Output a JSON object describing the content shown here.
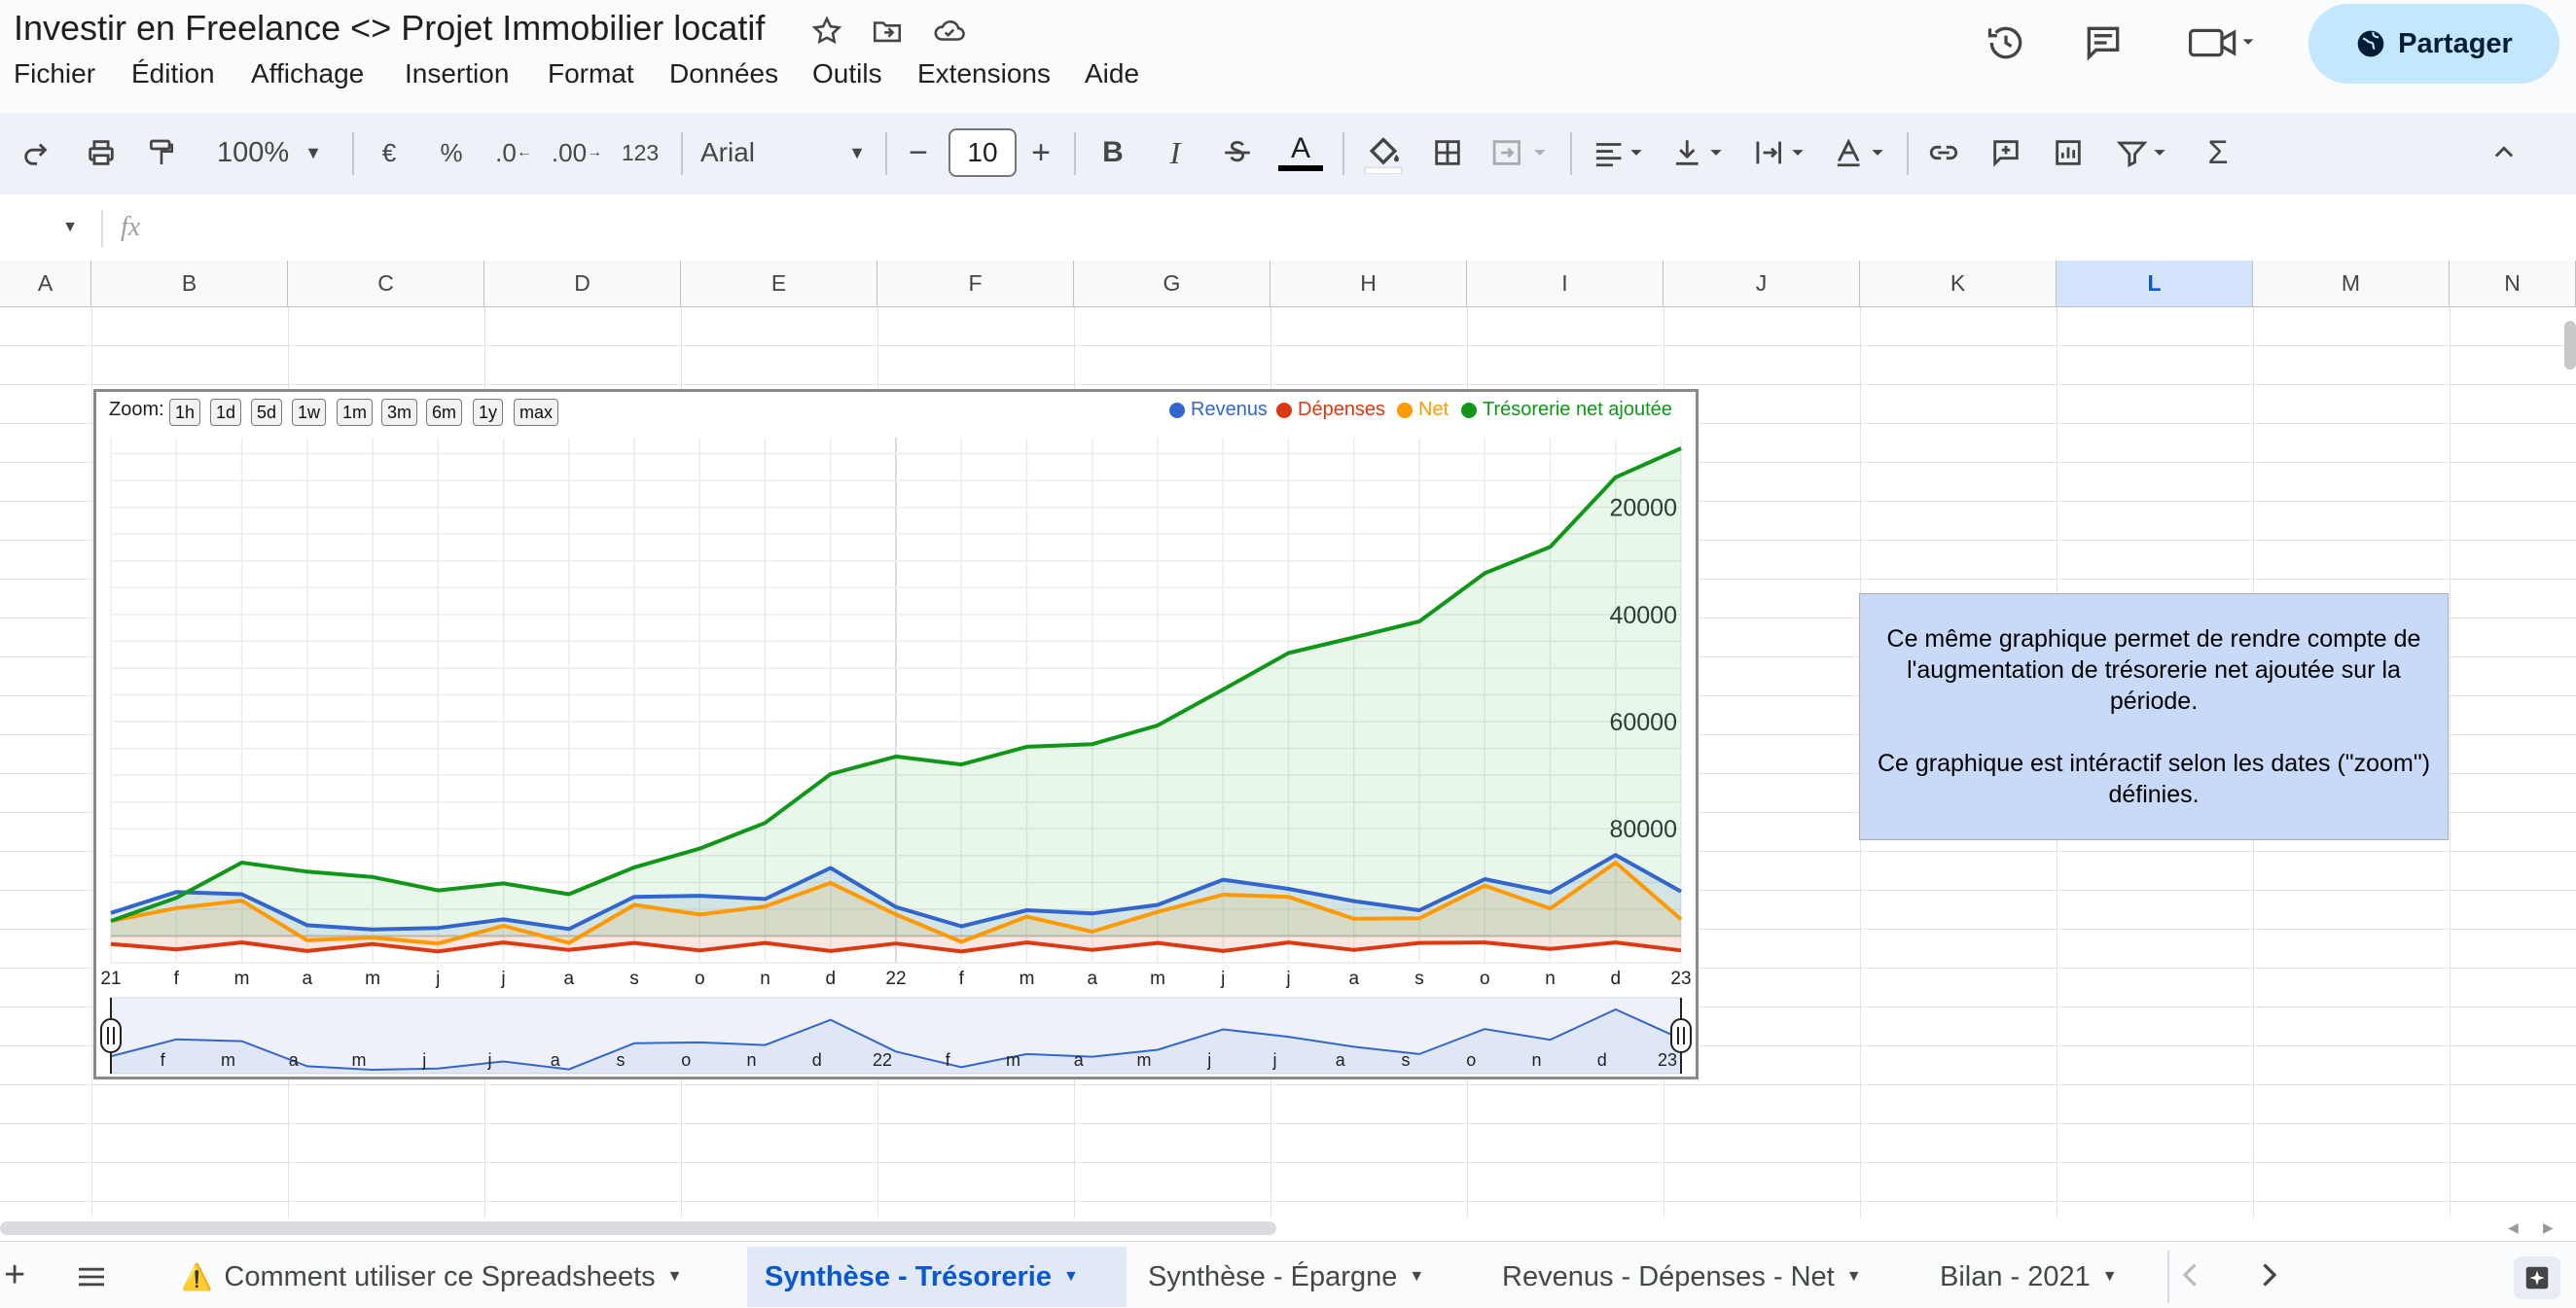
{
  "app": {
    "title": "Investir en Freelance <> Projet Immobilier locatif",
    "menus": [
      "Fichier",
      "Édition",
      "Affichage",
      "Insertion",
      "Format",
      "Données",
      "Outils",
      "Extensions",
      "Aide"
    ],
    "share_label": "Partager"
  },
  "toolbar": {
    "zoom": "100%",
    "currency": "€",
    "percent": "%",
    "dec_less": ".0",
    "dec_more": ".00",
    "number_format": "123",
    "font": "Arial",
    "font_size": "10",
    "minus": "−",
    "plus": "+",
    "bold": "B",
    "italic": "I",
    "text_color": "A",
    "sigma": "Σ"
  },
  "formula": {
    "fx": "fx",
    "value": ""
  },
  "columns": [
    "A",
    "B",
    "C",
    "D",
    "E",
    "F",
    "G",
    "H",
    "I",
    "J",
    "K",
    "L",
    "M",
    "N"
  ],
  "selected_column": "L",
  "chart": {
    "zoom_label": "Zoom:",
    "zoom_options": [
      "1h",
      "1d",
      "5d",
      "1w",
      "1m",
      "3m",
      "6m",
      "1y",
      "max"
    ],
    "legend": [
      {
        "name": "Revenus",
        "color": "#3366cc"
      },
      {
        "name": "Dépenses",
        "color": "#dc3912"
      },
      {
        "name": "Net",
        "color": "#ff9900"
      },
      {
        "name": "Trésorerie net ajoutée",
        "color": "#109618"
      }
    ],
    "y_ticks": [
      "80000",
      "60000",
      "40000",
      "20000"
    ],
    "x_ticks": [
      "21",
      "f",
      "m",
      "a",
      "m",
      "j",
      "j",
      "a",
      "s",
      "o",
      "n",
      "d",
      "22",
      "f",
      "m",
      "a",
      "m",
      "j",
      "j",
      "a",
      "s",
      "o",
      "n",
      "d",
      "23"
    ],
    "range_ticks": [
      "f",
      "m",
      "a",
      "m",
      "j",
      "j",
      "a",
      "s",
      "o",
      "n",
      "d",
      "22",
      "f",
      "m",
      "a",
      "m",
      "j",
      "j",
      "a",
      "s",
      "o",
      "n",
      "d",
      "23"
    ]
  },
  "chart_data": {
    "type": "area",
    "x": [
      "2021-01",
      "2021-02",
      "2021-03",
      "2021-04",
      "2021-05",
      "2021-06",
      "2021-07",
      "2021-08",
      "2021-09",
      "2021-10",
      "2021-11",
      "2021-12",
      "2022-01",
      "2022-02",
      "2022-03",
      "2022-04",
      "2022-05",
      "2022-06",
      "2022-07",
      "2022-08",
      "2022-09",
      "2022-10",
      "2022-11",
      "2022-12",
      "2023-01"
    ],
    "ylim": [
      -5000,
      93000
    ],
    "y_ticks": [
      20000,
      40000,
      60000,
      80000
    ],
    "legend_position": "top-right",
    "series": [
      {
        "name": "Revenus",
        "values": [
          4300,
          8200,
          7800,
          2000,
          1200,
          1500,
          3100,
          1300,
          7300,
          7500,
          6900,
          12700,
          5400,
          1800,
          4800,
          4200,
          5800,
          10500,
          8800,
          6500,
          4800,
          10600,
          8100,
          15100,
          8300
        ]
      },
      {
        "name": "Dépenses",
        "values": [
          -1500,
          -2500,
          -1200,
          -2800,
          -1500,
          -2900,
          -1200,
          -2600,
          -1300,
          -2700,
          -1300,
          -2800,
          -1400,
          -2900,
          -1200,
          -2600,
          -1300,
          -2800,
          -1200,
          -2600,
          -1300,
          -1200,
          -2400,
          -1200,
          -2700
        ]
      },
      {
        "name": "Net",
        "values": [
          2800,
          5200,
          6600,
          -800,
          -300,
          -1400,
          1900,
          -1300,
          5800,
          4000,
          5500,
          9900,
          4000,
          -1100,
          3600,
          800,
          4500,
          7700,
          7300,
          3200,
          3300,
          9400,
          5100,
          13700,
          3100
        ]
      },
      {
        "name": "Trésorerie net ajoutée",
        "values": [
          2800,
          7100,
          13700,
          12000,
          11000,
          8500,
          9800,
          7800,
          12800,
          16300,
          21100,
          30200,
          33500,
          32000,
          35300,
          35800,
          39300,
          46000,
          52800,
          55700,
          58700,
          67700,
          72600,
          85600,
          91000
        ]
      }
    ]
  },
  "note": {
    "line1": "Ce même graphique permet de rendre compte de l'augmentation de trésorerie net ajoutée sur la période.",
    "line2": "Ce graphique est intéractif selon les dates (\"zoom\") définies."
  },
  "sheets": [
    {
      "label": "Comment utiliser ce Spreadsheets",
      "warning": "⚠️"
    },
    {
      "label": "Synthèse - Trésorerie",
      "active": true
    },
    {
      "label": "Synthèse - Épargne"
    },
    {
      "label": "Revenus - Dépenses - Net"
    },
    {
      "label": "Bilan - 2021"
    }
  ]
}
